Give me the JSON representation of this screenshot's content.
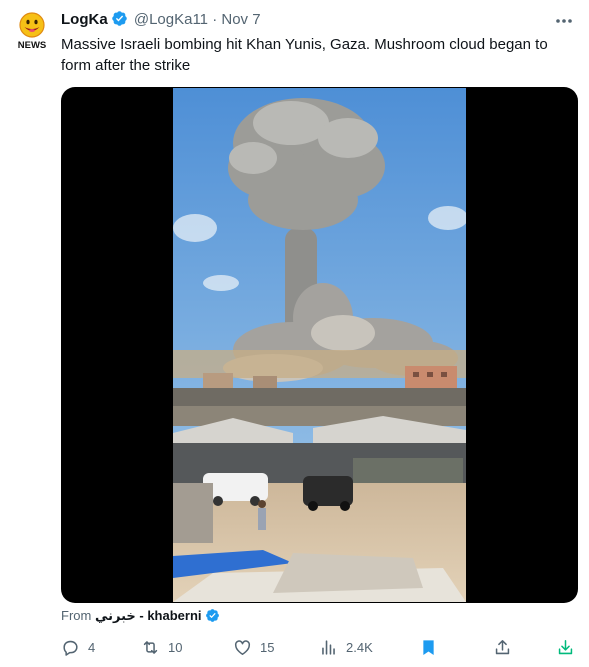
{
  "tweet": {
    "display_name": "LogKa",
    "handle": "@LogKa11",
    "separator": "·",
    "date": "Nov 7",
    "avatar_text": "NEWS",
    "text": "Massive Israeli bombing hit Khan Yunis, Gaza. Mushroom cloud began to form after the strike",
    "media_type": "video",
    "from_label": "From",
    "source_name": "خبرني - khaberni",
    "verified_color": "#1d9bf0",
    "accent_color": "#1d9bf0"
  },
  "actions": {
    "replies": "4",
    "reposts": "10",
    "likes": "15",
    "views": "2.4K",
    "icons": [
      "reply-icon",
      "repost-icon",
      "like-icon",
      "views-icon",
      "bookmark-icon",
      "share-icon",
      "download-icon"
    ]
  }
}
